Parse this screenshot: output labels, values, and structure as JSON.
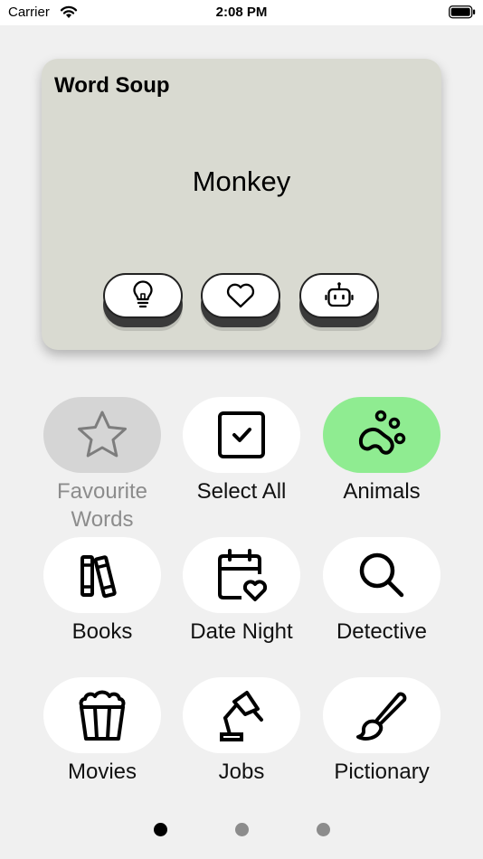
{
  "status_bar": {
    "carrier": "Carrier",
    "time": "2:08 PM"
  },
  "card": {
    "title": "Word Soup",
    "word": "Monkey",
    "buttons": [
      {
        "icon": "lightbulb-icon"
      },
      {
        "icon": "heart-icon"
      },
      {
        "icon": "robot-icon"
      }
    ]
  },
  "categories": [
    {
      "label": "Favourite Words",
      "icon": "star-icon",
      "state": "disabled"
    },
    {
      "label": "Select All",
      "icon": "checkbox-icon",
      "state": "normal"
    },
    {
      "label": "Animals",
      "icon": "paw-icon",
      "state": "selected"
    },
    {
      "label": "Books",
      "icon": "books-icon",
      "state": "normal"
    },
    {
      "label": "Date Night",
      "icon": "calendar-heart-icon",
      "state": "normal"
    },
    {
      "label": "Detective",
      "icon": "magnifier-icon",
      "state": "normal"
    },
    {
      "label": "Movies",
      "icon": "popcorn-icon",
      "state": "normal"
    },
    {
      "label": "Jobs",
      "icon": "desk-lamp-icon",
      "state": "normal"
    },
    {
      "label": "Pictionary",
      "icon": "paintbrush-icon",
      "state": "normal"
    }
  ],
  "pagination": {
    "pages": 3,
    "current": 1
  },
  "colors": {
    "background": "#f0f0f0",
    "card": "#d9dad1",
    "selected": "#8fec91",
    "disabled": "#d5d5d5"
  }
}
